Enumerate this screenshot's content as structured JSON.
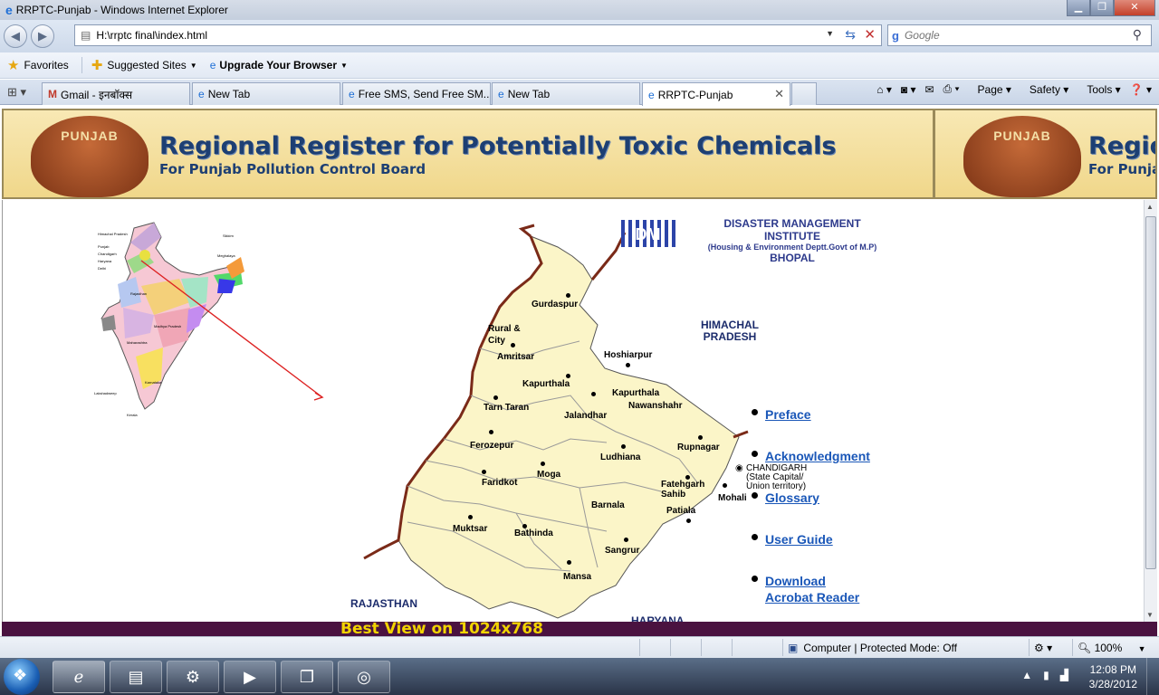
{
  "window": {
    "title": "RRPTC-Punjab - Windows Internet Explorer"
  },
  "address": {
    "url": "H:\\rrptc final\\index.html"
  },
  "search": {
    "placeholder": "Google"
  },
  "favorites": {
    "label": "Favorites",
    "suggested": "Suggested Sites",
    "upgrade": "Upgrade Your Browser"
  },
  "tabs": [
    {
      "label": "Gmail - इनबॉक्स"
    },
    {
      "label": "New Tab"
    },
    {
      "label": "Free SMS, Send Free SM..."
    },
    {
      "label": "New Tab"
    },
    {
      "label": "RRPTC-Punjab"
    }
  ],
  "toolbar": {
    "page": "Page",
    "safety": "Safety",
    "tools": "Tools"
  },
  "banner": {
    "seal": "PUNJAB",
    "title": "Regional Register for Potentially Toxic Chemicals",
    "subtitle": "For Punjab Pollution Control Board"
  },
  "dmi": {
    "name": "DISASTER MANAGEMENT INSTITUTE",
    "sub": "(Housing & Environment Deptt.Govt of M.P)",
    "city": "BHOPAL"
  },
  "map": {
    "neighbors": {
      "himachal": "HIMACHAL PRADESH",
      "rajasthan": "RAJASTHAN",
      "haryana": "HARYANA"
    },
    "districts": [
      "Gurdaspur",
      "Rural & City",
      "Amritsar",
      "Hoshiarpur",
      "Kapurthala",
      "Kapurthala",
      "Nawanshahr",
      "Tarn Taran",
      "Jalandhar",
      "Ferozepur",
      "Rupnagar",
      "Ludhiana",
      "Faridkot",
      "Moga",
      "Fatehgarh Sahib",
      "Mohali",
      "Barnala",
      "Patiala",
      "Muktsar",
      "Bathinda",
      "Sangrur",
      "Mansa"
    ],
    "chandigarh": "CHANDIGARH (State Capital/ Union territory)"
  },
  "links": {
    "preface": "Preface",
    "ack": "Acknowledgment",
    "glossary": "Glossary",
    "guide": "User Guide",
    "download1": "Download",
    "download2": "Acrobat Reader"
  },
  "footer": {
    "bestview": "Best View on 1024x768"
  },
  "status": {
    "zone": "Computer | Protected Mode: Off",
    "zoom": "100%"
  },
  "clock": {
    "time": "12:08 PM",
    "date": "3/28/2012"
  }
}
